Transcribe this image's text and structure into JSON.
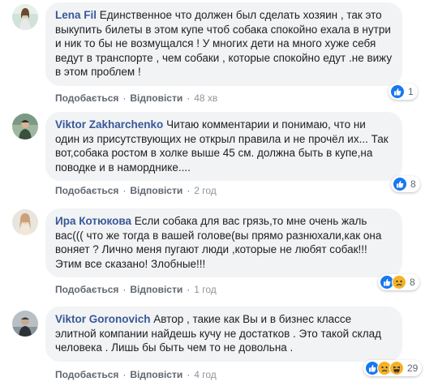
{
  "colors": {
    "author": "#385898",
    "bubble_bg": "#f2f3f5",
    "meta": "#606770",
    "like_blue": "#1877f2",
    "emoji_yellow": "#f7b125"
  },
  "comments": [
    {
      "author": "Lena Fil",
      "text": "Единственное что должен был сделать хозяин , так это выкупить билеты в этом купе чтоб собака спокойно ехала в нутри и ник то бы не возмущался ! У многих дети на много хуже себя ведут в транспорте , чем собаки , которые спокойно едут .не вижу в этом проблем !",
      "like_label": "Подобається",
      "reply_label": "Відповісти",
      "time": "48 хв",
      "reaction_icons": [
        "like-icon"
      ],
      "reaction_count": "1"
    },
    {
      "author": "Viktor Zakharchenko",
      "text": "Читаю комментарии и понимаю, что ни один из присутствующих не открыл правила и не прочёл их... Так вот,собака ростом в холке выше 45 см. должна быть в купе,на поводке и в наморднике....",
      "like_label": "Подобається",
      "reply_label": "Відповісти",
      "time": "2 год",
      "reaction_icons": [
        "like-icon"
      ],
      "reaction_count": "8"
    },
    {
      "author": "Ира Котюкова",
      "text": "Если собака для вас грязь,то мне очень жаль вас((( что же тогда в вашей голове(вы прямо разнюхали,как она воняет ? Лично меня пугают люди ,которые не любят собак!!! Этим все сказано! Злобные!!!",
      "like_label": "Подобається",
      "reply_label": "Відповісти",
      "time": "1 год",
      "reaction_icons": [
        "like-icon",
        "sad-icon"
      ],
      "reaction_count": "8"
    },
    {
      "author": "Viktor Goronovich",
      "text": "Автор , такие как Вы и в бизнес классе элитной компании найдешь кучу не достатков . Это такой склад человека . Лишь бы быть чем то не довольна .",
      "like_label": "Подобається",
      "reply_label": "Відповісти",
      "time": "4 год",
      "reaction_icons": [
        "like-icon",
        "sad-icon",
        "haha-icon"
      ],
      "reaction_count": "29"
    }
  ]
}
